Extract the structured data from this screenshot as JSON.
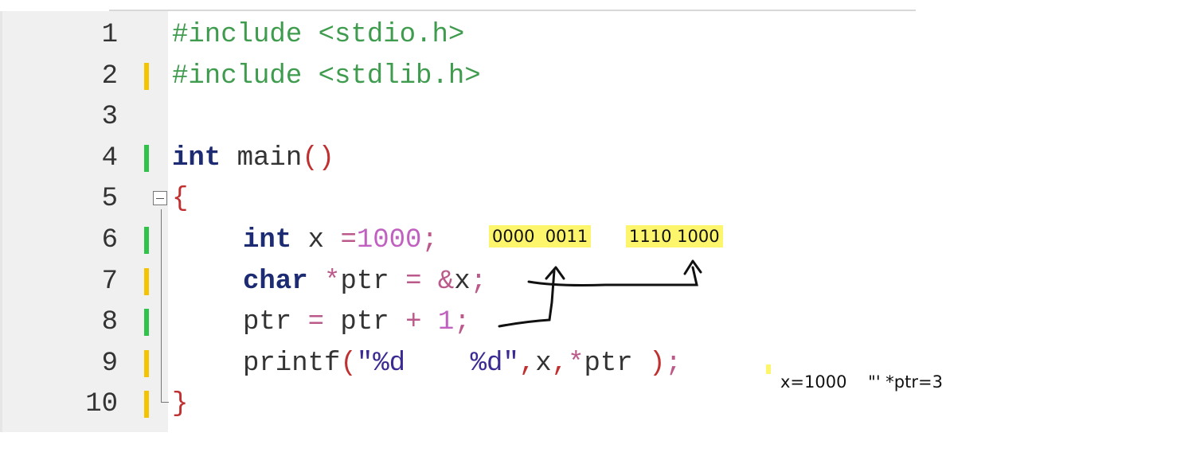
{
  "editor": {
    "lines": [
      {
        "number": "1",
        "text": "#include <stdio.h>"
      },
      {
        "number": "2",
        "text": "#include <stdlib.h>"
      },
      {
        "number": "3",
        "text": ""
      },
      {
        "number": "4",
        "text": "int main()"
      },
      {
        "number": "5",
        "text": "{"
      },
      {
        "number": "6",
        "text": "    int x =1000;"
      },
      {
        "number": "7",
        "text": "    char *ptr = &x;"
      },
      {
        "number": "8",
        "text": "    ptr = ptr + 1;"
      },
      {
        "number": "9",
        "text": "    printf(\"%d    %d\",x,*ptr );"
      },
      {
        "number": "10",
        "text": "}"
      }
    ],
    "tokens": {
      "l1_directive": "#include",
      "l1_header": "<stdio.h>",
      "l2_directive": "#include",
      "l2_header": "<stdlib.h>",
      "l4_kw": "int",
      "l4_name": " main",
      "l4_parens": "()",
      "l5_brace": "{",
      "l6_kw": "int",
      "l6_var": " x ",
      "l6_eq": "=",
      "l6_num": "1000",
      "l6_semi": ";",
      "l7_kw": "char",
      "l7_star": " *",
      "l7_var": "ptr ",
      "l7_eq": "=",
      "l7_amp": " &",
      "l7_x": "x",
      "l7_semi": ";",
      "l8_a": "ptr ",
      "l8_eq": "=",
      "l8_b": " ptr ",
      "l8_plus": "+",
      "l8_num": " 1",
      "l8_semi": ";",
      "l9_fn": "printf",
      "l9_open": "(",
      "l9_str": "\"%d    %d\"",
      "l9_c1": ",",
      "l9_x": "x",
      "l9_c2": ",",
      "l9_star": "*",
      "l9_ptr": "ptr ",
      "l9_close": ")",
      "l9_semi": ";",
      "l10_brace": "}"
    },
    "change_markers": {
      "yellow": "#f5c400",
      "green": "#2ec44a"
    }
  },
  "annotations": {
    "bytes_high": "0000  0011",
    "bytes_low": "1110 1000",
    "result": "x=1000    \"' *ptr=3",
    "highlight_color": "#fdf56b",
    "ink_color": "#111111"
  }
}
